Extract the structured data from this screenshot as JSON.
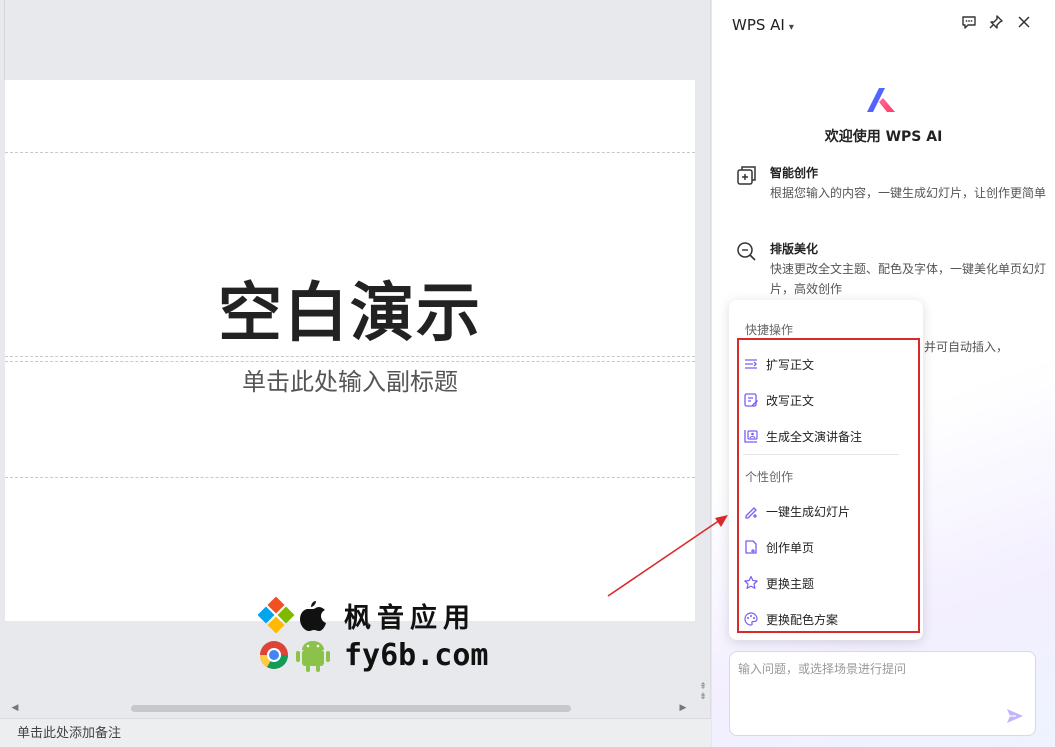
{
  "editor": {
    "slide": {
      "title": "空白演示",
      "subtitle": "单击此处输入副标题"
    },
    "watermark": {
      "line1": "枫音应用",
      "line2": "fy6b.com"
    },
    "notes_placeholder": "单击此处添加备注"
  },
  "panel": {
    "title": "WPS AI",
    "welcome": "欢迎使用 WPS AI",
    "features": [
      {
        "title": "智能创作",
        "desc": "根据您输入的内容，一键生成幻灯片，让创作更简单",
        "icon": "add-slide-icon"
      },
      {
        "title": "排版美化",
        "desc": "快速更改全文主题、配色及字体，一键美化单页幻灯片，高效创作",
        "icon": "magnifier-sparkle-icon"
      }
    ],
    "partial_text": "并可自动插入，",
    "popup": {
      "section1": "快捷操作",
      "quick_actions": [
        {
          "label": "扩写正文",
          "icon": "expand-text-icon"
        },
        {
          "label": "改写正文",
          "icon": "rewrite-text-icon"
        },
        {
          "label": "生成全文演讲备注",
          "icon": "speaker-notes-icon"
        }
      ],
      "section2": "个性创作",
      "creative_actions": [
        {
          "label": "一键生成幻灯片",
          "icon": "magic-pen-icon"
        },
        {
          "label": "创作单页",
          "icon": "new-page-icon"
        },
        {
          "label": "更换主题",
          "icon": "star-theme-icon"
        },
        {
          "label": "更换配色方案",
          "icon": "palette-icon"
        }
      ]
    },
    "input": {
      "placeholder": "输入问题，或选择场景进行提问",
      "value": ""
    }
  },
  "colors": {
    "accent": "#7b5cf5",
    "annotation": "#d92a2a"
  }
}
